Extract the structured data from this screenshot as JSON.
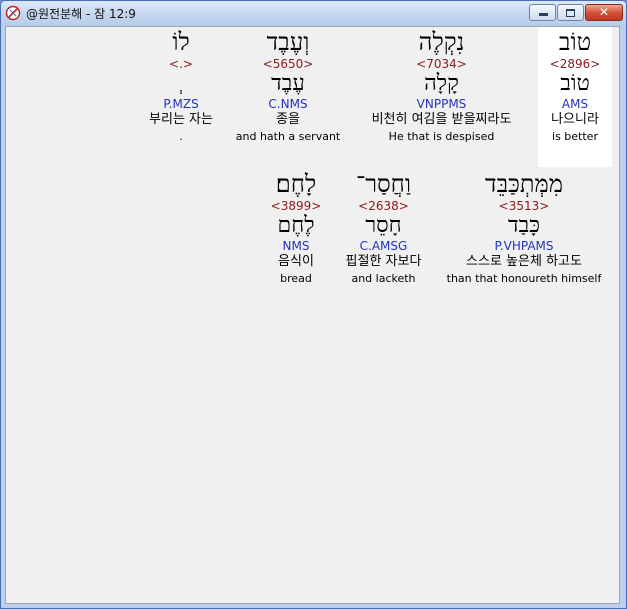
{
  "window": {
    "title": "@원전분해 - 잠 12:9",
    "close_glyph": "✕"
  },
  "rows": [
    [
      {
        "hebrew": "טוֹב",
        "strong": "<2896>",
        "lemma": "טוֹב",
        "morph": "AMS",
        "korean": "나으니라",
        "english": "is better",
        "highlight": true
      },
      {
        "hebrew": "נִקְלֶה",
        "strong": "<7034>",
        "lemma": "קָלָה",
        "morph": "VNPPMS",
        "korean": "비천히 여김을 받을찌라도",
        "english": "He that is despised",
        "highlight": false
      },
      {
        "hebrew": "וְעֶבֶד",
        "strong": "<5650>",
        "lemma": "עֶבֶד",
        "morph": "C.NMS",
        "korean": "종을",
        "english": "and hath a servant",
        "highlight": false
      },
      {
        "hebrew": "לוֹ",
        "strong": "<.>",
        "lemma": "ְ",
        "morph": "P.MZS",
        "korean": "부리는 자는",
        "english": ".",
        "highlight": false
      }
    ],
    [
      {
        "hebrew": "מִמְּתְכַּבֵּד",
        "strong": "<3513>",
        "lemma": "כָּבַד",
        "morph": "P.VHPAMS",
        "korean": "스스로 높은체 하고도",
        "english": "than that honoureth himself",
        "highlight": false
      },
      {
        "hebrew": "וַחֲסַר־",
        "strong": "<2638>",
        "lemma": "חָסֵר",
        "morph": "C.AMSG",
        "korean": "핍절한 자보다",
        "english": "and lacketh",
        "highlight": false
      },
      {
        "hebrew": "לָחֶם׃",
        "strong": "<3899>",
        "lemma": "לֶחֶם",
        "morph": "NMS",
        "korean": "음식이",
        "english": "bread",
        "highlight": false
      }
    ]
  ]
}
